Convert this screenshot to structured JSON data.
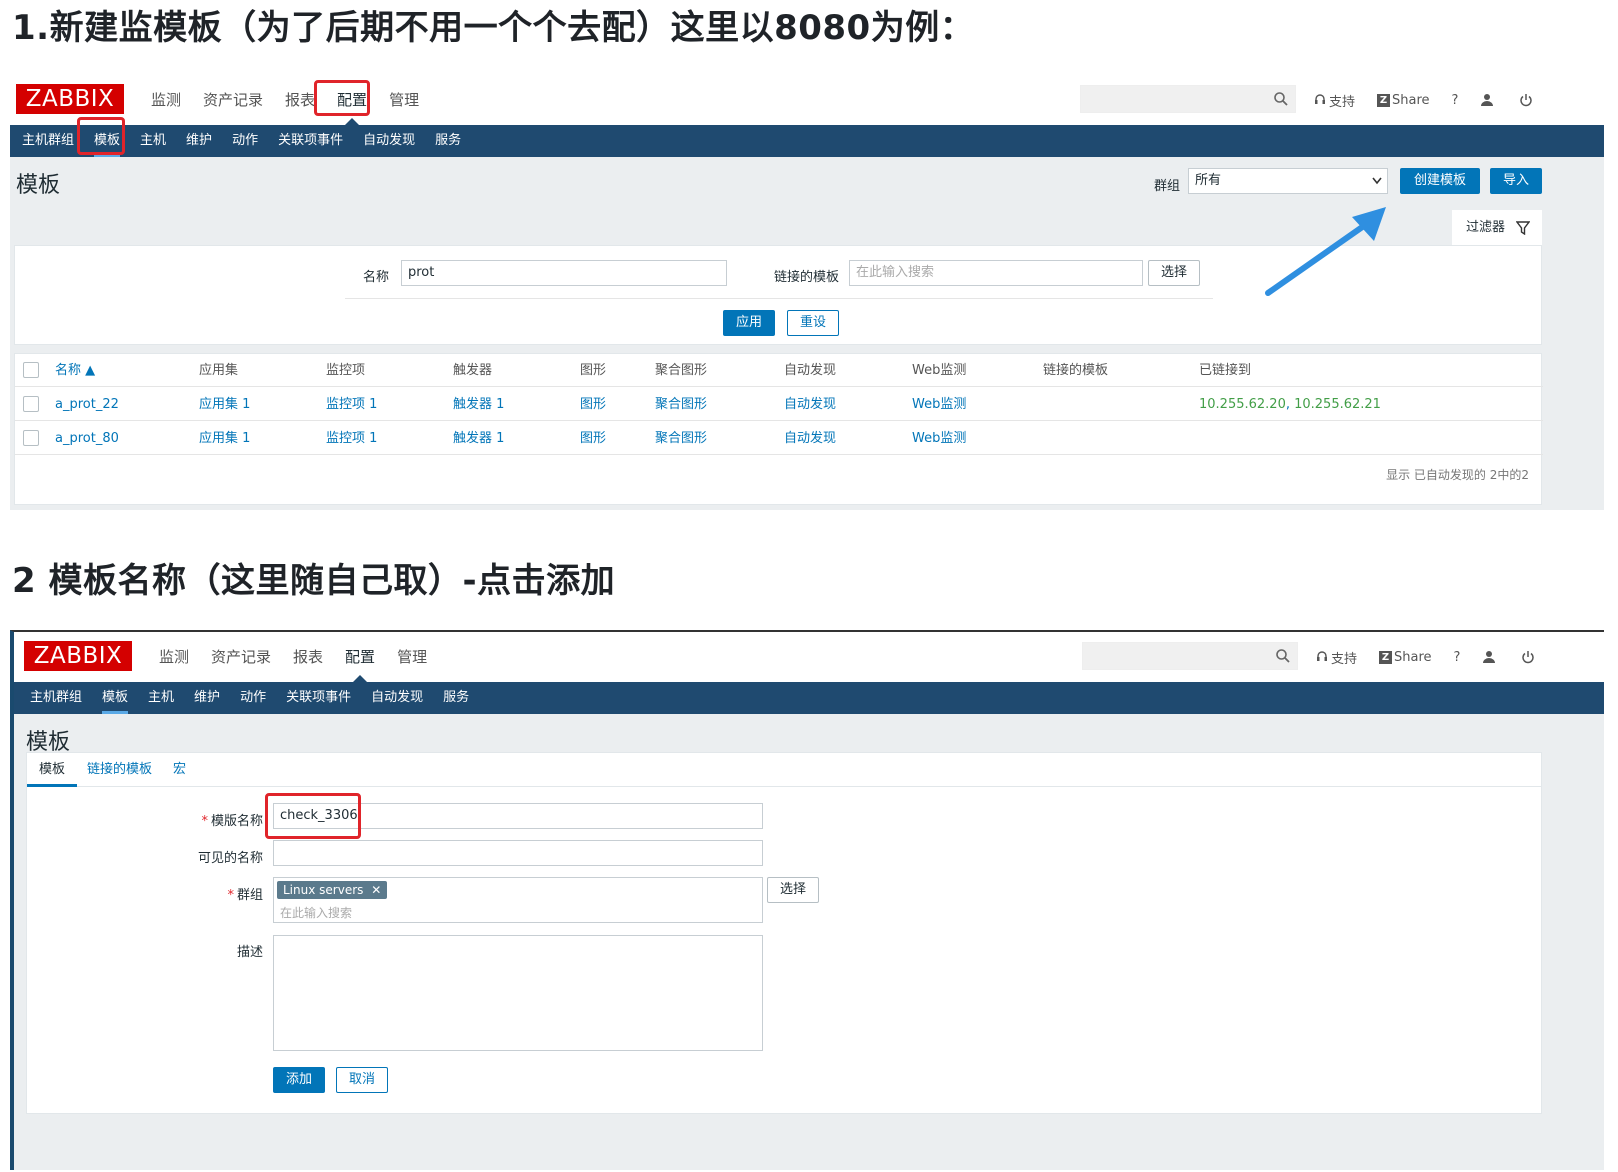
{
  "headings": {
    "step1": "1.新建监模板（为了后期不用一个个去配）这里以8080为例：",
    "step2": "2 模板名称（这里随自己取）-点击添加"
  },
  "app": {
    "logo": "ZABBIX",
    "main_menu": [
      "监测",
      "资产记录",
      "报表",
      "配置",
      "管理"
    ],
    "sub_menu": [
      "主机群组",
      "模板",
      "主机",
      "维护",
      "动作",
      "关联项事件",
      "自动发现",
      "服务"
    ],
    "top_links": {
      "support": "支持",
      "share": "Share",
      "help": "?"
    },
    "page_title": "模板",
    "accent_color": "#1f4a70",
    "logo_color": "#d40000",
    "link_color": "#0275b8",
    "highlight_color": "#e0242a"
  },
  "screenshot1": {
    "group_label": "群组",
    "group_value": "所有",
    "create_button": "创建模板",
    "import_button": "导入",
    "filter_tab": "过滤器",
    "filter": {
      "name_label": "名称",
      "name_value": "prot",
      "linked_label": "链接的模板",
      "linked_placeholder": "在此输入搜索",
      "select_button": "选择",
      "apply_button": "应用",
      "reset_button": "重设"
    },
    "table": {
      "headers": [
        "名称 ▲",
        "应用集",
        "监控项",
        "触发器",
        "图形",
        "聚合图形",
        "自动发现",
        "Web监测",
        "链接的模板",
        "已链接到"
      ],
      "rows": [
        {
          "name": "a_prot_22",
          "apps": "应用集 1",
          "items": "监控项 1",
          "triggers": "触发器 1",
          "graphs": "图形",
          "screens": "聚合图形",
          "discovery": "自动发现",
          "web": "Web监测",
          "linked": "",
          "linked_to_a": "10.255.62.20",
          "sep": ", ",
          "linked_to_b": "10.255.62.21"
        },
        {
          "name": "a_prot_80",
          "apps": "应用集 1",
          "items": "监控项 1",
          "triggers": "触发器 1",
          "graphs": "图形",
          "screens": "聚合图形",
          "discovery": "自动发现",
          "web": "Web监测",
          "linked": "",
          "linked_to_a": "",
          "sep": "",
          "linked_to_b": ""
        }
      ],
      "footer": "显示 已自动发现的 2中的2"
    }
  },
  "screenshot2": {
    "tabs": [
      "模板",
      "链接的模板",
      "宏"
    ],
    "form": {
      "template_name_label": "模版名称",
      "template_name_value": "check_3306",
      "visible_name_label": "可见的名称",
      "group_label": "群组",
      "group_tag": "Linux servers",
      "group_placeholder": "在此输入搜索",
      "select_button": "选择",
      "description_label": "描述",
      "add_button": "添加",
      "cancel_button": "取消"
    }
  }
}
